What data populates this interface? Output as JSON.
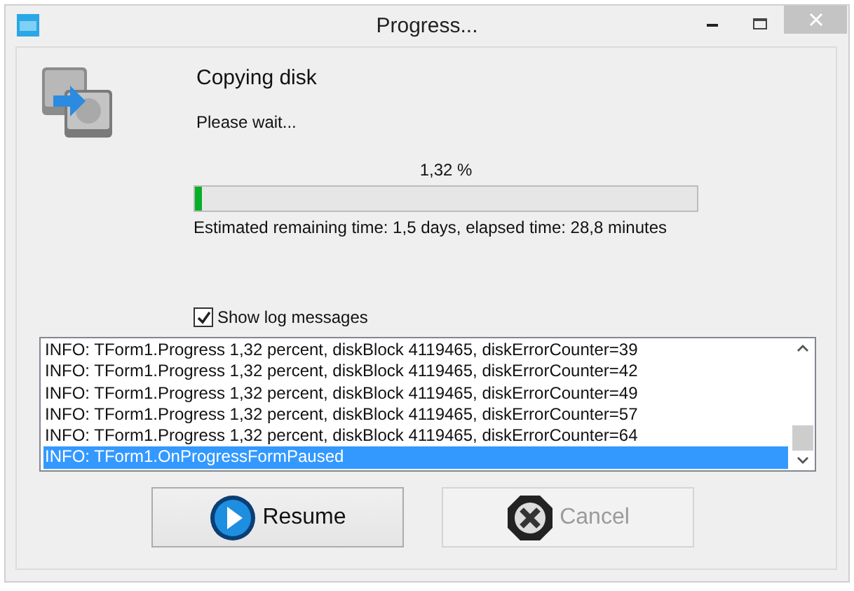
{
  "window": {
    "title": "Progress..."
  },
  "heading": "Copying disk",
  "subtitle": "Please wait...",
  "progress": {
    "label": "1,32 %",
    "level": 0.0132
  },
  "estimate": "Estimated remaining time: 1,5 days, elapsed time: 28,8 minutes",
  "show_log": {
    "label": "Show log messages",
    "checked": true
  },
  "log": [
    {
      "text": "INFO: TForm1.Progress 1,32 percent, diskBlock 4119465, diskErrorCounter=39",
      "selected": false
    },
    {
      "text": "INFO: TForm1.Progress 1,32 percent, diskBlock 4119465, diskErrorCounter=42",
      "selected": false
    },
    {
      "text": "INFO: TForm1.Progress 1,32 percent, diskBlock 4119465, diskErrorCounter=49",
      "selected": false
    },
    {
      "text": "INFO: TForm1.Progress 1,32 percent, diskBlock 4119465, diskErrorCounter=57",
      "selected": false
    },
    {
      "text": "INFO: TForm1.Progress 1,32 percent, diskBlock 4119465, diskErrorCounter=64",
      "selected": false
    },
    {
      "text": "INFO: TForm1.OnProgressFormPaused",
      "selected": true
    }
  ],
  "buttons": [
    {
      "label": "Resume",
      "kind": "resume",
      "disabled": false
    },
    {
      "label": "Cancel",
      "kind": "cancel",
      "disabled": true
    }
  ]
}
